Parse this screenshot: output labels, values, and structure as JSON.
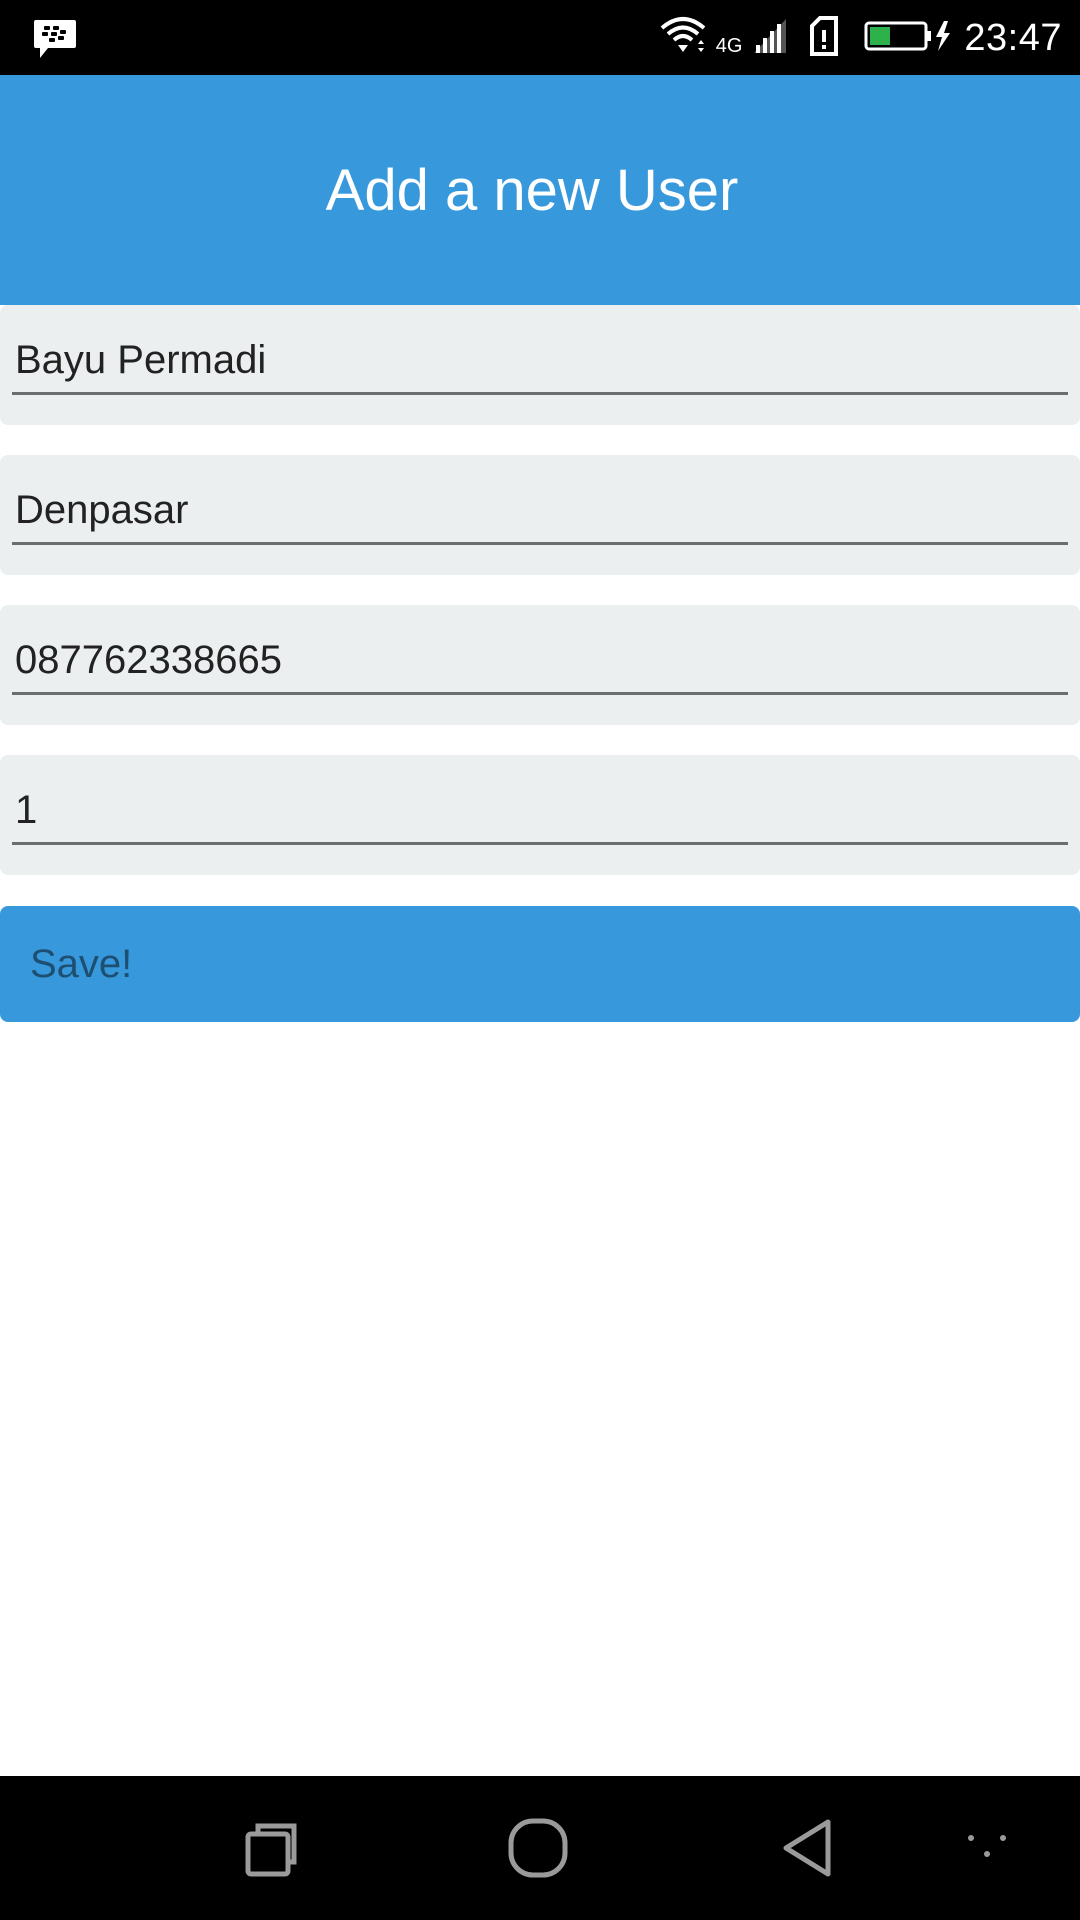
{
  "status_bar": {
    "time": "23:47",
    "network_label": "4G",
    "icons": [
      "bbm-icon",
      "wifi-icon",
      "cellular-signal-icon",
      "sim-card-icon",
      "battery-charging-icon"
    ],
    "battery_color": "#2db14a"
  },
  "header": {
    "title": "Add a new User",
    "background": "#3799dc"
  },
  "form": {
    "fields": [
      {
        "value": "Bayu Permadi"
      },
      {
        "value": "Denpasar"
      },
      {
        "value": "087762338665"
      },
      {
        "value": "1"
      }
    ],
    "save_label": "Save!"
  },
  "nav_bar": {
    "icons": [
      "recent-apps-icon",
      "home-icon",
      "back-icon",
      "more-icon"
    ]
  }
}
